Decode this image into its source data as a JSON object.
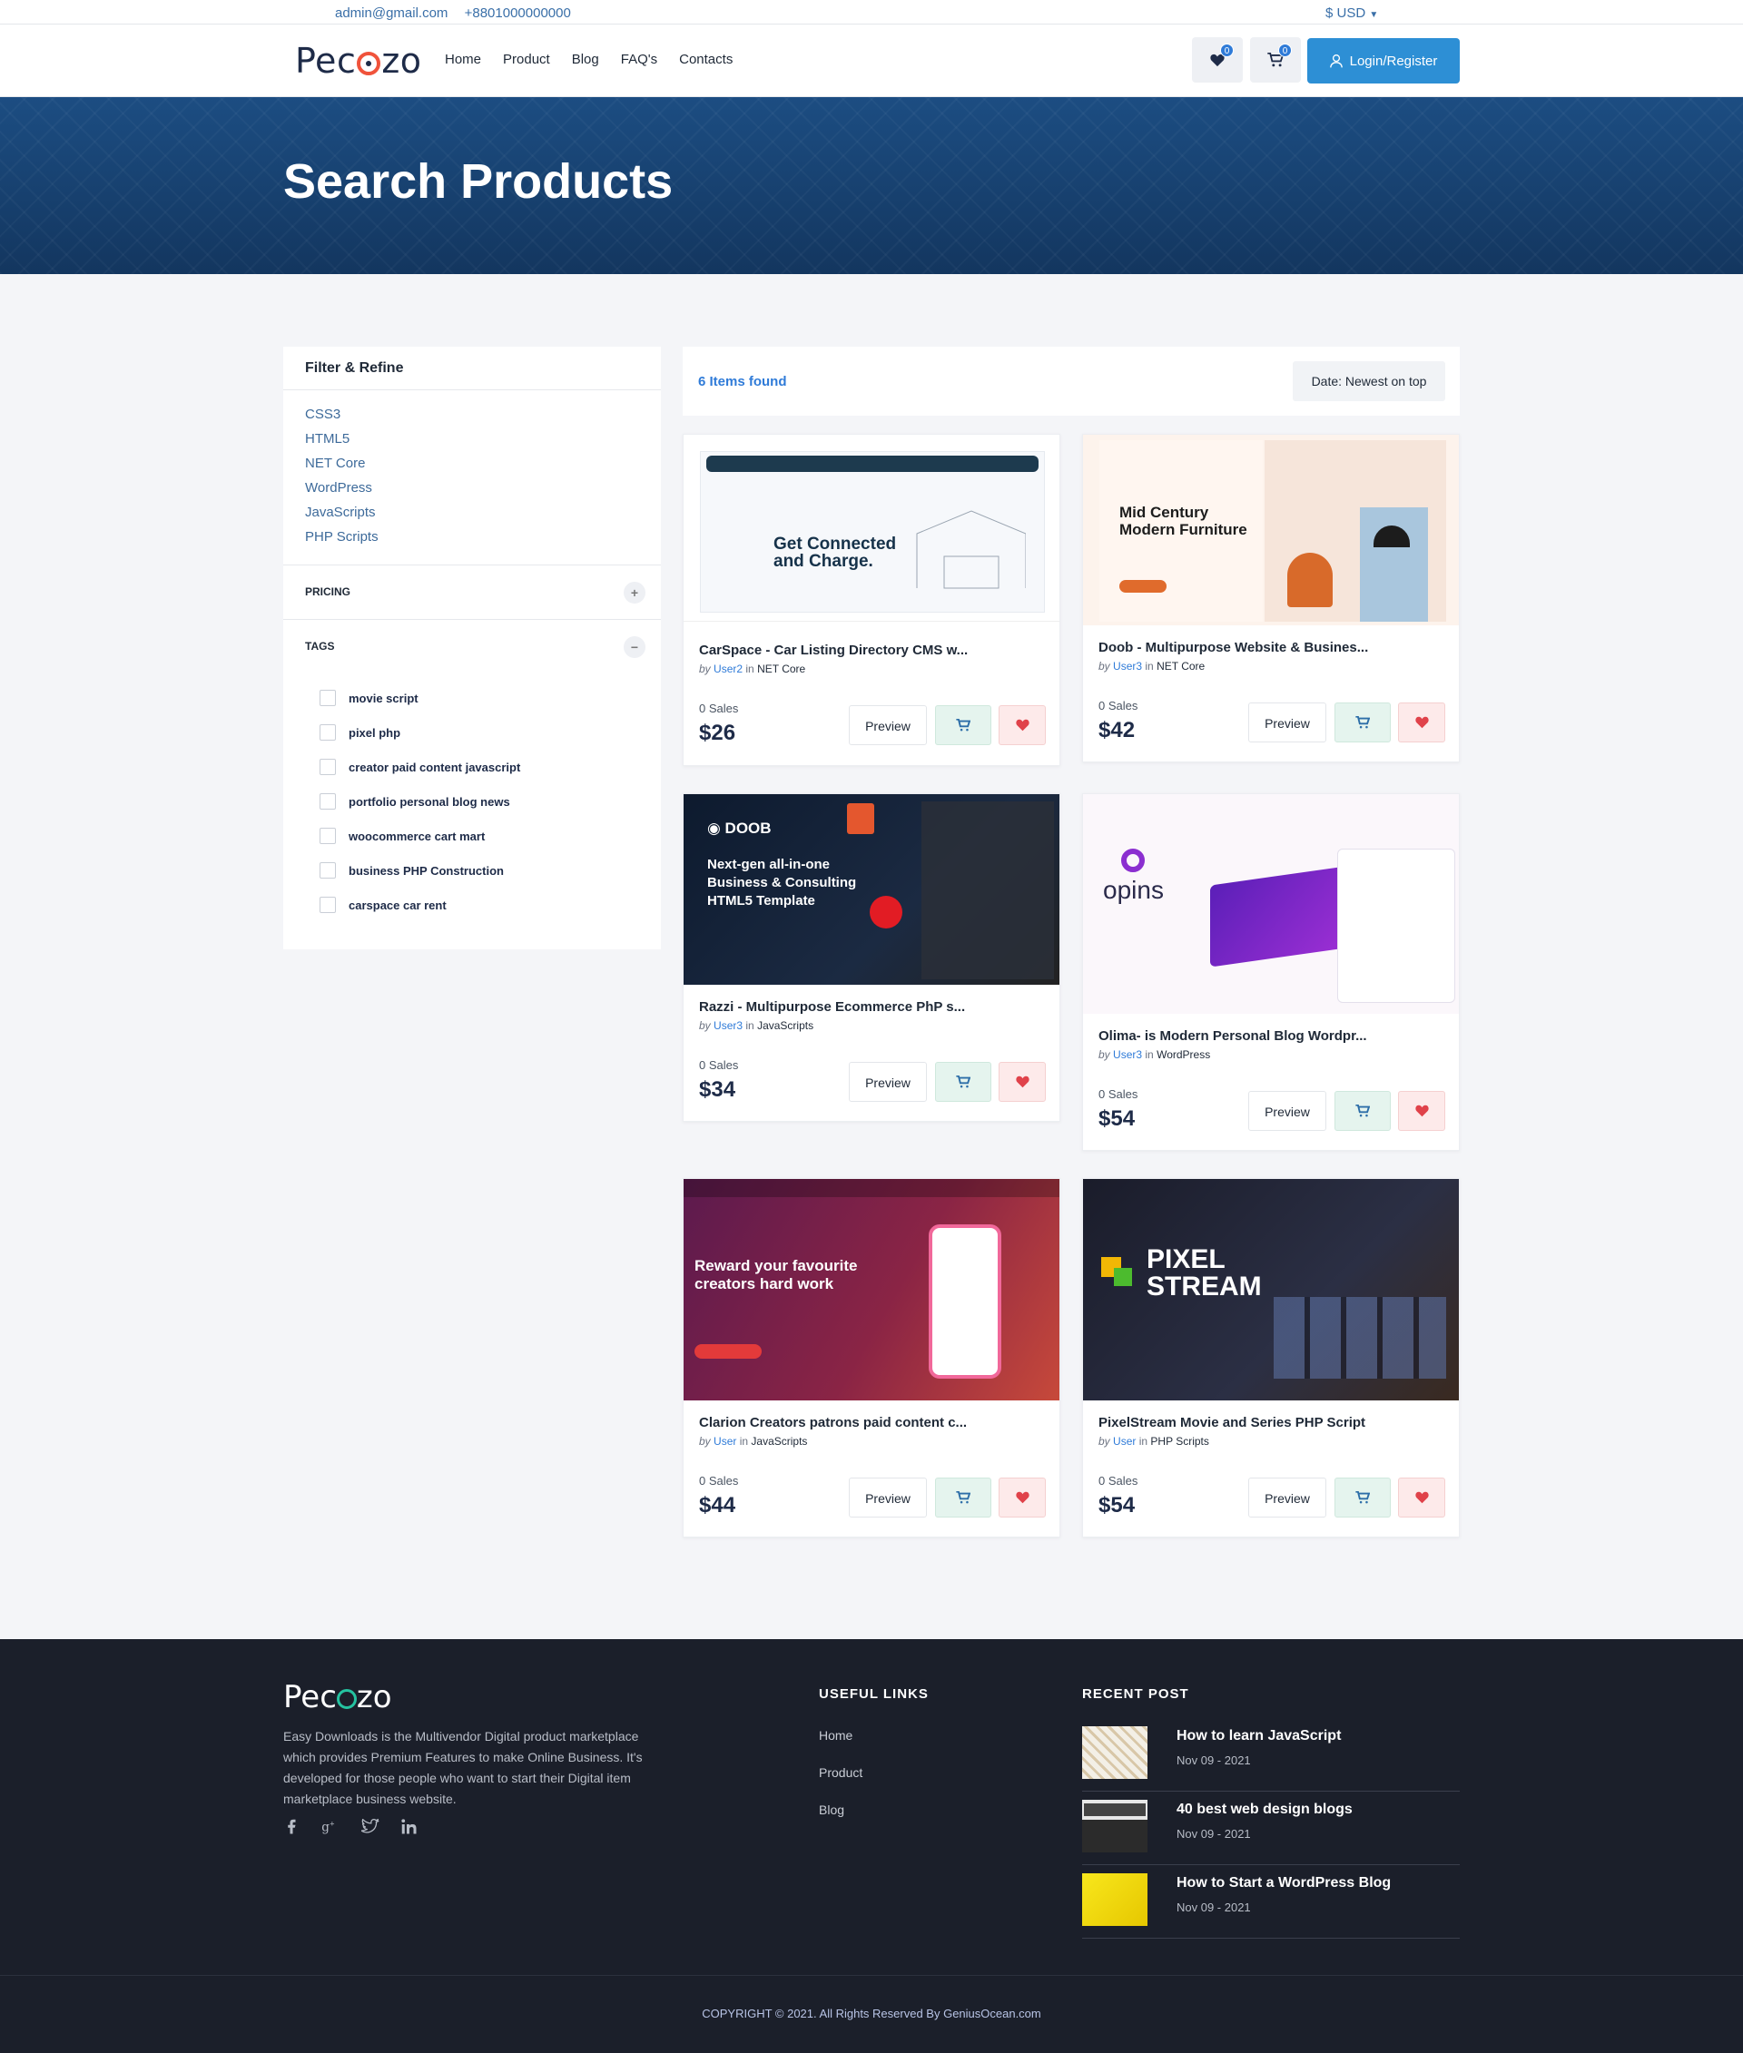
{
  "topbar": {
    "email": "admin@gmail.com",
    "phone": "+8801000000000",
    "currency": "$  USD"
  },
  "header": {
    "logo": "Pecozo",
    "nav": [
      "Home",
      "Product",
      "Blog",
      "FAQ's",
      "Contacts"
    ],
    "wishlist_count": "0",
    "cart_count": "0",
    "login_label": "Login/Register"
  },
  "hero": {
    "title": "Search Products"
  },
  "sidebar": {
    "title": "Filter & Refine",
    "categories": [
      "CSS3",
      "HTML5",
      "NET Core",
      "WordPress",
      "JavaScripts",
      "PHP Scripts"
    ],
    "pricing_label": "PRICING",
    "tags_label": "TAGS",
    "tags": [
      "movie script",
      "pixel php",
      "creator paid content javascript",
      "portfolio personal blog news",
      "woocommerce cart mart",
      "business PHP Construction",
      "carspace car rent"
    ]
  },
  "results": {
    "count": "6 Items found",
    "sort": "Date: Newest on top"
  },
  "labels": {
    "by": "by",
    "in": "in",
    "preview": "Preview"
  },
  "products": [
    {
      "title": "CarSpace - Car Listing Directory CMS w...",
      "user": "User2",
      "category": "NET Core",
      "sales": "0 Sales",
      "price": "$26",
      "thumb_text": "Get Connected and Charge."
    },
    {
      "title": "Doob - Multipurpose Website & Busines...",
      "user": "User3",
      "category": "NET Core",
      "sales": "0 Sales",
      "price": "$42",
      "thumb_text": "Mid Century Modern Furniture"
    },
    {
      "title": "Razzi - Multipurpose Ecommerce PhP s...",
      "user": "User3",
      "category": "JavaScripts",
      "sales": "0 Sales",
      "price": "$34",
      "thumb_text": "Next-gen all-in-one Business & Consulting HTML5 Template"
    },
    {
      "title": "Olima- is Modern Personal Blog Wordpr...",
      "user": "User3",
      "category": "WordPress",
      "sales": "0 Sales",
      "price": "$54",
      "thumb_text": "opins"
    },
    {
      "title": "Clarion Creators patrons paid content c...",
      "user": "User",
      "category": "JavaScripts",
      "sales": "0 Sales",
      "price": "$44",
      "thumb_text": "Reward your favourite creators hard work"
    },
    {
      "title": "PixelStream Movie and Series PHP Script",
      "user": "User",
      "category": "PHP Scripts",
      "sales": "0 Sales",
      "price": "$54",
      "thumb_text": "PIXEL STREAM"
    }
  ],
  "footer": {
    "logo": "Pecozo",
    "description": "Easy Downloads is the Multivendor Digital product marketplace which provides Premium Features to make Online Business. It's developed for those people who want to start their Digital item marketplace business website.",
    "useful_links_title": "USEFUL LINKS",
    "useful_links": [
      "Home",
      "Product",
      "Blog"
    ],
    "recent_post_title": "RECENT POST",
    "posts": [
      {
        "title": "How to learn JavaScript",
        "date": "Nov 09 - 2021"
      },
      {
        "title": "40 best web design blogs",
        "date": "Nov 09 - 2021"
      },
      {
        "title": "How to Start a WordPress Blog",
        "date": "Nov 09 - 2021"
      }
    ],
    "copyright": "COPYRIGHT © 2021. All Rights Reserved By GeniusOcean.com"
  },
  "colors": {
    "primary": "#2d8fd5",
    "hero": "#174372",
    "footer": "#1b1f2a"
  }
}
